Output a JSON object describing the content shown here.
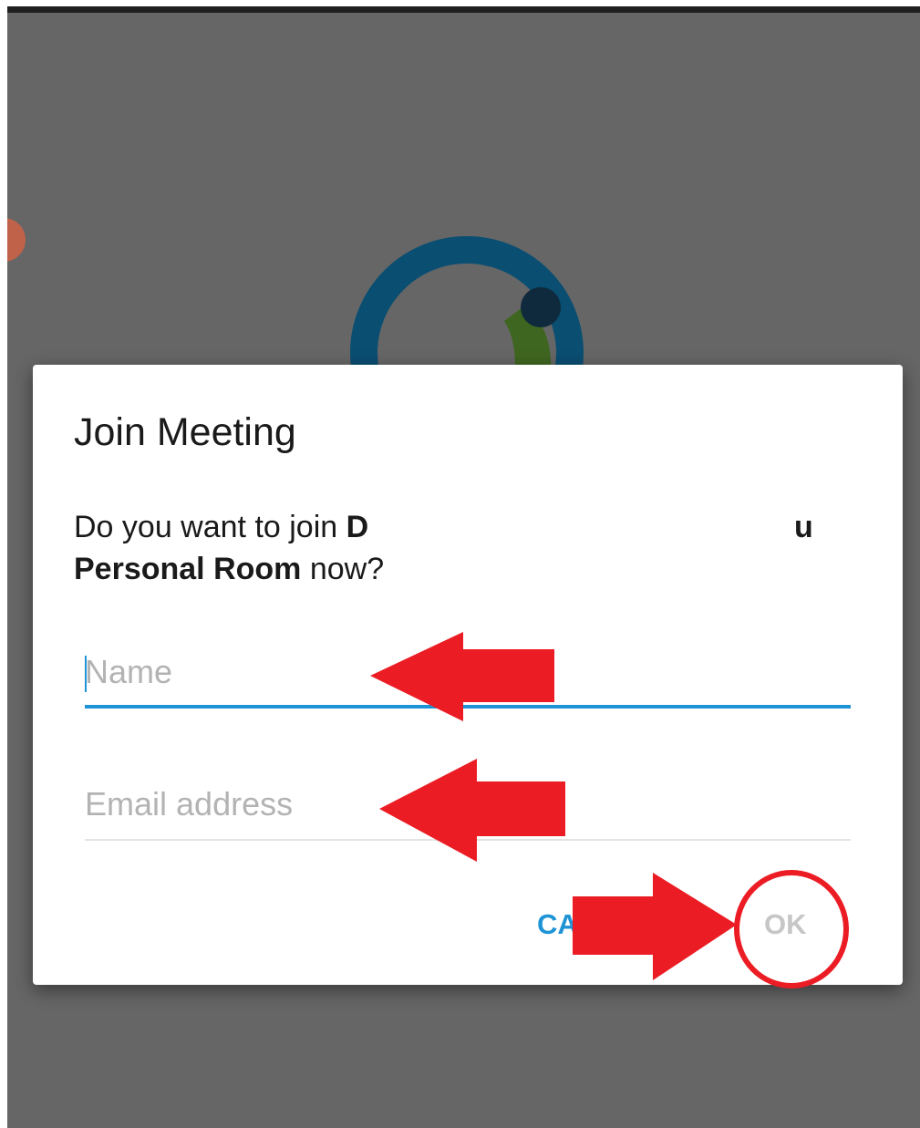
{
  "dialog": {
    "title": "Join Meeting",
    "message": {
      "prefix": "Do you want to join ",
      "host_start": "D",
      "host_end": "u",
      "room": "Personal Room",
      "suffix": " now?"
    },
    "name_field": {
      "placeholder": "Name"
    },
    "email_field": {
      "placeholder": "Email address"
    },
    "cancel_label": "CANCEL",
    "ok_label": "OK"
  },
  "colors": {
    "accent": "#1e94d6",
    "annotation": "#ec1c24",
    "overlay": "#666666"
  },
  "annotations": [
    "arrow-left-icon",
    "arrow-left-icon",
    "arrow-right-icon",
    "circle-highlight-icon"
  ]
}
